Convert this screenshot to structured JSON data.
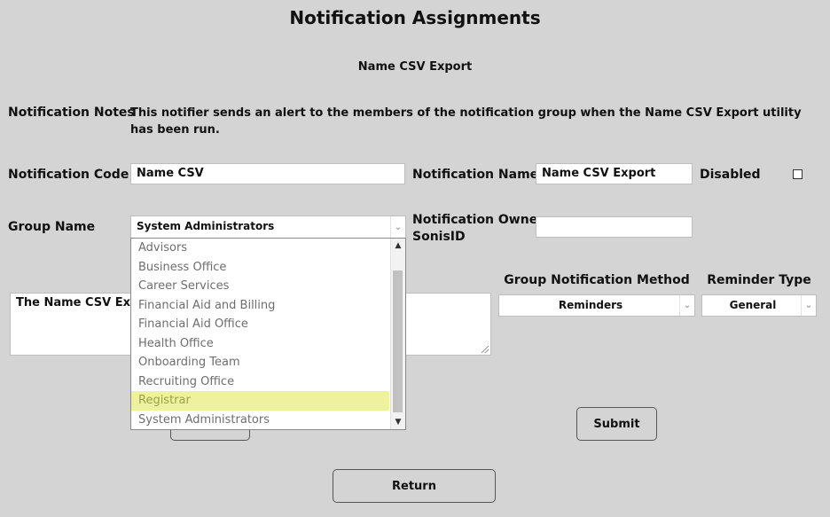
{
  "page": {
    "title": "Notification Assignments",
    "subtitle": "Name CSV Export"
  },
  "form": {
    "notes_label": "Notification Notes",
    "notes_text": "This notifier sends an alert to the members of the notification group when the Name CSV Export utility has been run.",
    "code_label": "Notification Code",
    "code_value": "Name CSV",
    "name_label": "Notification Name",
    "name_value": "Name CSV Export",
    "disabled_label": "Disabled",
    "group_label": "Group Name",
    "group_value": "System Administrators",
    "owner_label_line1": "Notification Owner",
    "owner_label_line2": "SonisID",
    "owner_value": "",
    "message_value": "The Name CSV Expo",
    "method_label": "Group Notification Method",
    "method_value": "Reminders",
    "reminder_label": "Reminder Type",
    "reminder_value": "General"
  },
  "dropdown": {
    "options": [
      "Advisors",
      "Business Office",
      "Career Services",
      "Financial Aid and Billing",
      "Financial Aid Office",
      "Health Office",
      "Onboarding Team",
      "Recruiting Office",
      "Registrar",
      "System Administrators"
    ],
    "highlighted": "Registrar"
  },
  "buttons": {
    "submit": "Submit",
    "return": "Return"
  },
  "icons": {
    "select_arrow": "chevron-down-icon",
    "scroll_up": "chevron-up-icon",
    "scroll_down": "chevron-down-icon"
  },
  "colors": {
    "background": "#d4d4d4",
    "highlight": "#eef29e"
  }
}
